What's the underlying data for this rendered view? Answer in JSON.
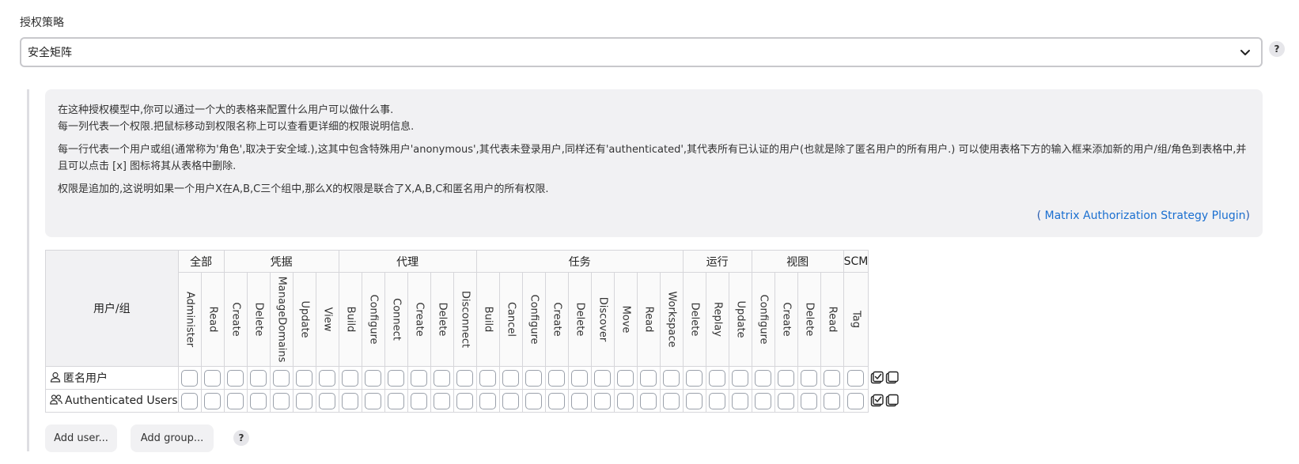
{
  "strategy": {
    "label": "授权策略",
    "selected": "安全矩阵",
    "help_icon": "?"
  },
  "description": {
    "line1": "在这种授权模型中,你可以通过一个大的表格来配置什么用户可以做什么事.",
    "line2": "每一列代表一个权限.把鼠标移动到权限名称上可以查看更详细的权限说明信息.",
    "para2": "每一行代表一个用户或组(通常称为'角色',取决于安全域.),这其中包含特殊用户'anonymous',其代表未登录用户,同样还有'authenticated',其代表所有已认证的用户(也就是除了匿名用户的所有用户.) 可以使用表格下方的输入框来添加新的用户/组/角色到表格中,并且可以点击 [x] 图标将其从表格中删除.",
    "para3": "权限是追加的,这说明如果一个用户X在A,B,C三个组中,那么X的权限是联合了X,A,B,C和匿名用户的所有权限.",
    "link_open": "( ",
    "link_text": "Matrix Authorization Strategy Plugin",
    "link_close": ")"
  },
  "matrix": {
    "user_column_header": "用户/组",
    "groups": [
      {
        "name": "全部",
        "permissions": [
          "Administer",
          "Read"
        ]
      },
      {
        "name": "凭据",
        "permissions": [
          "Create",
          "Delete",
          "ManageDomains",
          "Update",
          "View"
        ]
      },
      {
        "name": "代理",
        "permissions": [
          "Build",
          "Configure",
          "Connect",
          "Create",
          "Delete",
          "Disconnect"
        ]
      },
      {
        "name": "任务",
        "permissions": [
          "Build",
          "Cancel",
          "Configure",
          "Create",
          "Delete",
          "Discover",
          "Move",
          "Read",
          "Workspace"
        ]
      },
      {
        "name": "运行",
        "permissions": [
          "Delete",
          "Replay",
          "Update"
        ]
      },
      {
        "name": "视图",
        "permissions": [
          "Configure",
          "Create",
          "Delete",
          "Read"
        ]
      },
      {
        "name": "SCM",
        "permissions": [
          "Tag"
        ]
      }
    ],
    "rows": [
      {
        "label": "匿名用户",
        "icon": "user-icon"
      },
      {
        "label": "Authenticated Users",
        "icon": "group-icon"
      }
    ],
    "row_actions": [
      "select-all-icon",
      "unselect-all-icon"
    ]
  },
  "buttons": {
    "add_user": "Add user...",
    "add_group": "Add group...",
    "help_icon": "?"
  },
  "colors": {
    "link": "#1a6fd0",
    "panel_bg": "#f1f1f3",
    "border": "#d6d6da"
  }
}
